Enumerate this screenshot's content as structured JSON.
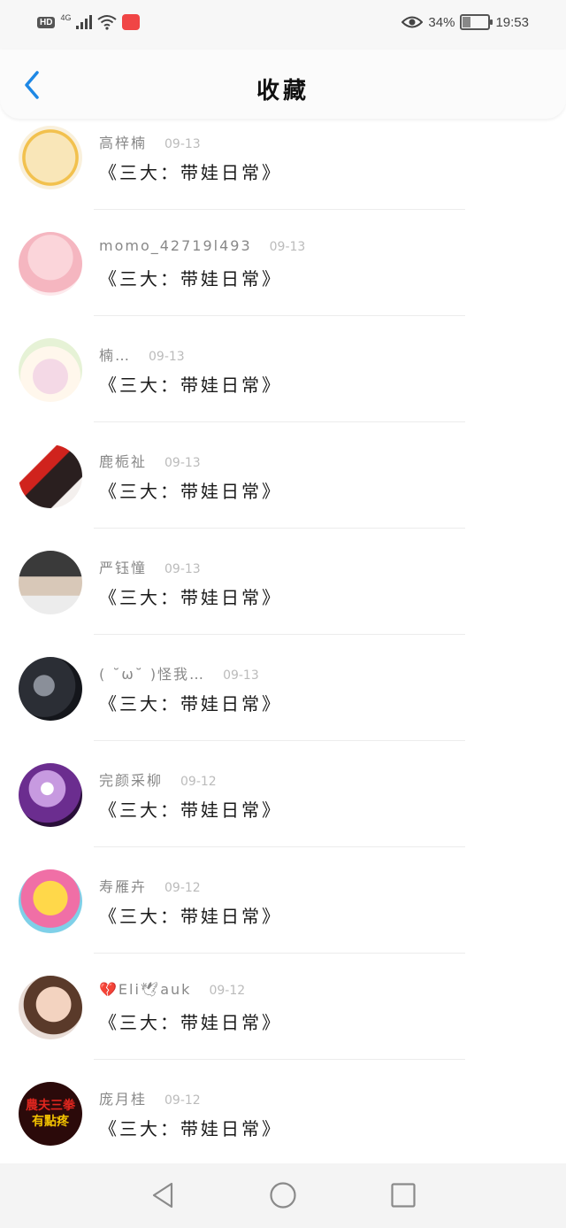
{
  "status": {
    "hd": "HD",
    "network": "4G",
    "battery_pct": "34%",
    "battery_level": 0.34,
    "time": "19:53"
  },
  "header": {
    "title": "收藏"
  },
  "accent": "#1e88e5",
  "items": [
    {
      "name": "高梓楠",
      "date": "09-13",
      "title": "《三大：带娃日常》"
    },
    {
      "name": "momo_42719l493",
      "date": "09-13",
      "title": "《三大：带娃日常》"
    },
    {
      "name": "楠…",
      "date": "09-13",
      "title": "《三大：带娃日常》"
    },
    {
      "name": "鹿栀祉",
      "date": "09-13",
      "title": "《三大：带娃日常》"
    },
    {
      "name": "严钰憧",
      "date": "09-13",
      "title": "《三大：带娃日常》"
    },
    {
      "name": "( ˘ω˘ )怪我…",
      "date": "09-13",
      "title": "《三大：带娃日常》"
    },
    {
      "name": "完颜采柳",
      "date": "09-12",
      "title": "《三大：带娃日常》"
    },
    {
      "name": "寿雁卉",
      "date": "09-12",
      "title": "《三大：带娃日常》"
    },
    {
      "name": "💔Eli🕊auk",
      "date": "09-12",
      "title": "《三大：带娃日常》"
    },
    {
      "name": "庞月桂",
      "date": "09-12",
      "title": "《三大：带娃日常》",
      "avatar_text": [
        "農夫三拳",
        "有點疼"
      ]
    }
  ]
}
